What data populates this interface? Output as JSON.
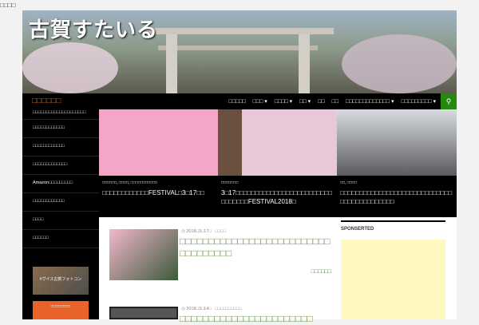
{
  "top_text": "□□□□",
  "header": {
    "logo": "古賀すたいる"
  },
  "nav": {
    "site_title": "□□□□□□",
    "items": [
      "□□□□□",
      "□□□ ▾",
      "□□□□ ▾",
      "□□ ▾",
      "□□",
      "□□",
      "□□□□□□□□□□□□□ ▾",
      "□□□□□□□□□ ▾"
    ],
    "search_icon": "search-icon"
  },
  "sidebar": {
    "items": [
      "□□□□□□□□□□□□□□□□□□□□",
      "□□□□□□□□□□□□",
      "□□□□□□□□□□□□",
      "□□□□□□□□□□□□□",
      "Amazon□□□□□□□□□",
      "□□□□□□□□□□□□",
      "□□□□",
      "□□□□□□"
    ],
    "banner1": "#ヴイス古賀フォトコン",
    "banner2": "□□□□□□□□"
  },
  "featured": [
    {
      "cat": "□□□□□□, □□□□, □□□□□□□□□□□",
      "title": "□□□□□□□□□□□□FESTIVAL□3□17□□"
    },
    {
      "cat": "□□□□□□□",
      "title": "3□17□□□□□□□□□□□□□□□□□□□□□□□□□□□□□□□□FESTIVAL2018□"
    },
    {
      "cat": "□□, □□□□",
      "title": "□□□□□□□□□□□□□□□□□□□□□□□□□□□□□□□□□□□□□□□□□□□"
    }
  ],
  "posts": [
    {
      "date": "◷ 2018□3□17□",
      "cat": "□□□□",
      "title": "□□□□□□□□□□□□□□□□□□□□□□□□□□□□□□□□□□□",
      "more": "□□□□□□"
    },
    {
      "date": "◷ 2018□3□14□",
      "cat": "□□□□□□□□□□",
      "title": "□□□□□□□□□□□□□□□□□□□□□□□"
    }
  ],
  "right_sidebar": {
    "heading": "SPONSERTED"
  }
}
